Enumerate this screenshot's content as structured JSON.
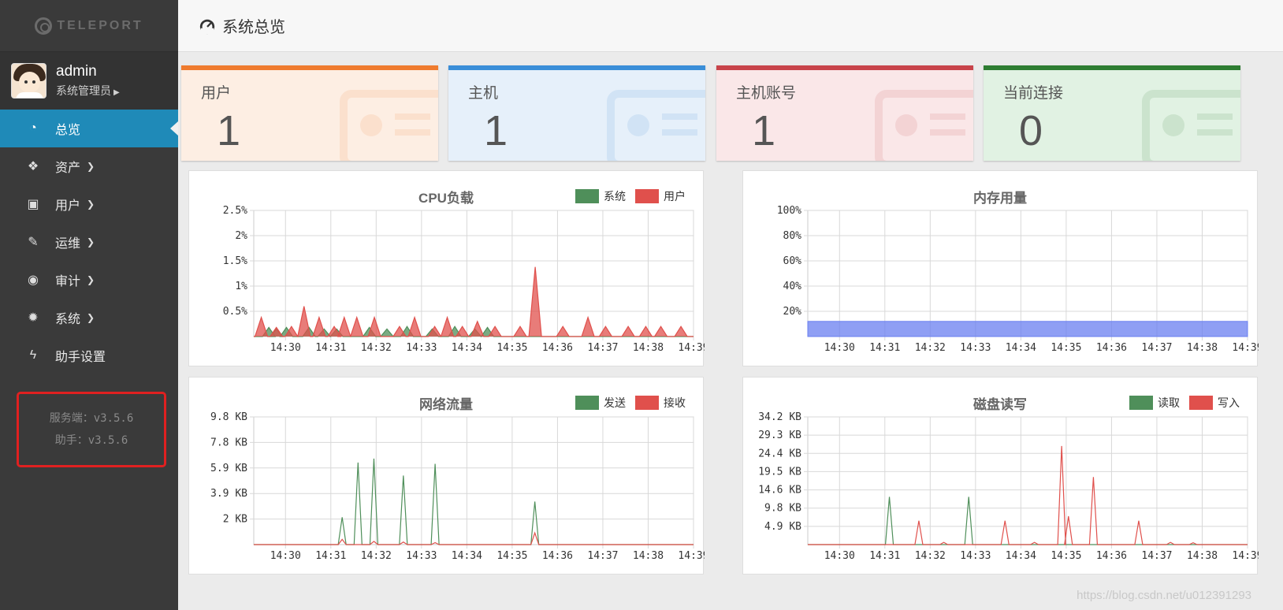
{
  "brand": {
    "logo_text": "TELEPORT"
  },
  "user": {
    "name": "admin",
    "role": "系统管理员"
  },
  "nav": {
    "items": [
      {
        "label": "总览",
        "icon": "gauge-icon",
        "active": true,
        "has_chevron": false
      },
      {
        "label": "资产",
        "icon": "cubes-icon",
        "active": false,
        "has_chevron": true
      },
      {
        "label": "用户",
        "icon": "address-book-icon",
        "active": false,
        "has_chevron": true
      },
      {
        "label": "运维",
        "icon": "wrench-icon",
        "active": false,
        "has_chevron": true
      },
      {
        "label": "审计",
        "icon": "eye-icon",
        "active": false,
        "has_chevron": true
      },
      {
        "label": "系统",
        "icon": "gear-icon",
        "active": false,
        "has_chevron": true
      },
      {
        "label": "助手设置",
        "icon": "bolt-icon",
        "active": false,
        "has_chevron": false
      }
    ]
  },
  "version": {
    "server": "服务端：v3.5.6",
    "assist": "助手：v3.5.6"
  },
  "page": {
    "title": "系统总览"
  },
  "stats": [
    {
      "title": "用户",
      "value": "1",
      "color": "#ef7b2e",
      "bg": "#fdeee3",
      "icon": "id-card-icon"
    },
    {
      "title": "主机",
      "value": "1",
      "color": "#3a8ed8",
      "bg": "#e6f0fa",
      "icon": "cubes-icon"
    },
    {
      "title": "主机账号",
      "value": "1",
      "color": "#c8434a",
      "bg": "#fae7e8",
      "icon": "spy-icon"
    },
    {
      "title": "当前连接",
      "value": "0",
      "color": "#2e7d32",
      "bg": "#e1f2e3",
      "icon": "link-icon"
    }
  ],
  "colors": {
    "green": "#4f8f5a",
    "red": "#e0504c",
    "blue": "#6a7ff0"
  },
  "watermark": "https://blog.csdn.net/u012391293",
  "chart_data": [
    {
      "type": "area",
      "title": "CPU负载",
      "x_ticks": [
        "14:30",
        "14:31",
        "14:32",
        "14:33",
        "14:34",
        "14:35",
        "14:36",
        "14:37",
        "14:38",
        "14:39"
      ],
      "y_ticks": [
        "2.5%",
        "2%",
        "1.5%",
        "1%",
        "0.5%"
      ],
      "ylim": [
        0,
        2.5
      ],
      "legend": [
        "系统",
        "用户"
      ],
      "series": [
        {
          "name": "系统",
          "color": "#4f8f5a",
          "peaks": [
            [
              0.6,
              0.18
            ],
            [
              0.9,
              0.15
            ],
            [
              1.3,
              0.18
            ],
            [
              2.2,
              0.18
            ],
            [
              2.8,
              0.15
            ],
            [
              3.3,
              0.15
            ],
            [
              4.6,
              0.18
            ],
            [
              5.3,
              0.15
            ],
            [
              6.1,
              0.2
            ],
            [
              7.1,
              0.15
            ],
            [
              8.0,
              0.2
            ],
            [
              8.8,
              0.15
            ],
            [
              9.3,
              0.18
            ]
          ]
        },
        {
          "name": "用户",
          "color": "#e0504c",
          "peaks": [
            [
              0.3,
              0.38
            ],
            [
              0.9,
              0.18
            ],
            [
              1.5,
              0.2
            ],
            [
              2.0,
              0.6
            ],
            [
              2.6,
              0.38
            ],
            [
              3.2,
              0.2
            ],
            [
              3.6,
              0.38
            ],
            [
              4.1,
              0.38
            ],
            [
              4.8,
              0.38
            ],
            [
              5.8,
              0.2
            ],
            [
              6.4,
              0.38
            ],
            [
              7.2,
              0.2
            ],
            [
              7.7,
              0.38
            ],
            [
              8.3,
              0.2
            ],
            [
              8.9,
              0.3
            ],
            [
              9.6,
              0.2
            ],
            [
              10.6,
              0.2
            ],
            [
              11.2,
              1.38
            ],
            [
              12.3,
              0.2
            ],
            [
              13.3,
              0.38
            ],
            [
              14.0,
              0.2
            ],
            [
              14.9,
              0.2
            ],
            [
              15.6,
              0.2
            ],
            [
              16.2,
              0.2
            ],
            [
              17.0,
              0.2
            ]
          ]
        }
      ]
    },
    {
      "type": "area",
      "title": "内存用量",
      "x_ticks": [
        "14:30",
        "14:31",
        "14:32",
        "14:33",
        "14:34",
        "14:35",
        "14:36",
        "14:37",
        "14:38",
        "14:39"
      ],
      "y_ticks": [
        "100%",
        "80%",
        "60%",
        "40%",
        "20%"
      ],
      "ylim": [
        0,
        100
      ],
      "series": [
        {
          "name": "",
          "color": "#6a7ff0",
          "level": 12
        }
      ]
    },
    {
      "type": "line",
      "title": "网络流量",
      "x_ticks": [
        "14:30",
        "14:31",
        "14:32",
        "14:33",
        "14:34",
        "14:35",
        "14:36",
        "14:37",
        "14:38",
        "14:39"
      ],
      "y_ticks": [
        "9.8 KB",
        "7.8 KB",
        "5.9 KB",
        "3.9 KB",
        "2 KB"
      ],
      "ylim": [
        0,
        9.8
      ],
      "legend": [
        "发送",
        "接收"
      ],
      "series": [
        {
          "name": "发送",
          "color": "#4f8f5a",
          "peaks": [
            [
              1.95,
              2.1
            ],
            [
              2.3,
              6.3
            ],
            [
              2.65,
              6.6
            ],
            [
              3.3,
              5.3
            ],
            [
              4.0,
              6.2
            ],
            [
              6.2,
              3.3
            ]
          ]
        },
        {
          "name": "接收",
          "color": "#e0504c",
          "peaks": [
            [
              1.95,
              0.4
            ],
            [
              2.65,
              0.25
            ],
            [
              3.3,
              0.2
            ],
            [
              4.0,
              0.15
            ],
            [
              6.2,
              0.9
            ]
          ]
        }
      ]
    },
    {
      "type": "line",
      "title": "磁盘读写",
      "x_ticks": [
        "14:30",
        "14:31",
        "14:32",
        "14:33",
        "14:34",
        "14:35",
        "14:36",
        "14:37",
        "14:38",
        "14:39"
      ],
      "y_ticks": [
        "34.2 KB",
        "29.3 KB",
        "24.4 KB",
        "19.5 KB",
        "14.6 KB",
        "9.8 KB",
        "4.9 KB"
      ],
      "ylim": [
        0,
        34.2
      ],
      "legend": [
        "读取",
        "写入"
      ],
      "series": [
        {
          "name": "读取",
          "color": "#4f8f5a",
          "peaks": [
            [
              1.8,
              12.8
            ],
            [
              3.55,
              12.8
            ]
          ]
        },
        {
          "name": "写入",
          "color": "#e0504c",
          "peaks": [
            [
              2.45,
              6.4
            ],
            [
              3.0,
              0.6
            ],
            [
              4.35,
              6.4
            ],
            [
              5.0,
              0.6
            ],
            [
              5.6,
              26.4
            ],
            [
              5.75,
              7.6
            ],
            [
              6.3,
              18.1
            ],
            [
              7.3,
              6.4
            ],
            [
              8.0,
              0.6
            ],
            [
              8.5,
              0.5
            ]
          ]
        }
      ]
    }
  ]
}
